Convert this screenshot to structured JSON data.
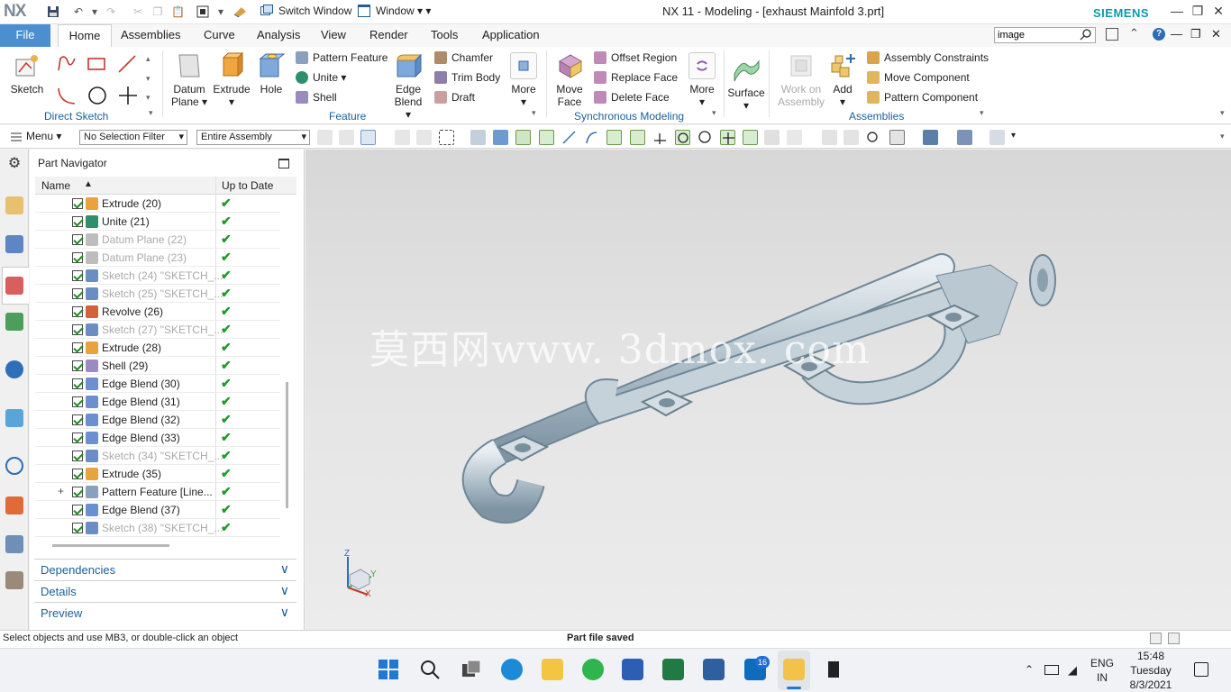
{
  "title_bar": {
    "logo": "NX",
    "switch_window": "Switch Window",
    "window_menu": "Window",
    "app_title": "NX 11 - Modeling - [exhaust Mainfold 3.prt]",
    "brand": "SIEMENS"
  },
  "tabs": {
    "file": "File",
    "items": [
      "Home",
      "Assemblies",
      "Curve",
      "Analysis",
      "View",
      "Render",
      "Tools",
      "Application"
    ],
    "active": "Home"
  },
  "search": {
    "value": "image"
  },
  "ribbon": {
    "sketch": "Sketch",
    "direct_sketch": "Direct Sketch",
    "datum_plane": "Datum Plane",
    "datum_plane_line1": "Datum",
    "datum_plane_line2": "Plane",
    "extrude": "Extrude",
    "hole": "Hole",
    "pattern_feature": "Pattern Feature",
    "unite": "Unite",
    "shell": "Shell",
    "edge_blend_line1": "Edge",
    "edge_blend_line2": "Blend",
    "chamfer": "Chamfer",
    "trim_body": "Trim Body",
    "draft": "Draft",
    "more": "More",
    "feature": "Feature",
    "move_face_line1": "Move",
    "move_face_line2": "Face",
    "offset_region": "Offset Region",
    "replace_face": "Replace Face",
    "delete_face": "Delete Face",
    "more2": "More",
    "synchronous_modeling": "Synchronous Modeling",
    "surface": "Surface",
    "work_on_line1": "Work on",
    "work_on_line2": "Assembly",
    "add": "Add",
    "assembly_constraints": "Assembly Constraints",
    "move_component": "Move Component",
    "pattern_component": "Pattern Component",
    "assemblies": "Assemblies"
  },
  "toolbar": {
    "menu": "Menu",
    "selection_filter": "No Selection Filter",
    "assembly_scope": "Entire Assembly"
  },
  "navigator": {
    "title": "Part Navigator",
    "col_name": "Name",
    "col_uptodate": "Up to Date",
    "rows": [
      {
        "label": "Extrude (20)",
        "dim": false,
        "color": "#e8a33c"
      },
      {
        "label": "Unite (21)",
        "dim": false,
        "color": "#2f8f6a"
      },
      {
        "label": "Datum Plane (22)",
        "dim": true,
        "color": "#bdbdbd"
      },
      {
        "label": "Datum Plane (23)",
        "dim": true,
        "color": "#bdbdbd"
      },
      {
        "label": "Sketch (24) \"SKETCH_...",
        "dim": true,
        "color": "#6a8ec4"
      },
      {
        "label": "Sketch (25) \"SKETCH_...",
        "dim": true,
        "color": "#6a8ec4"
      },
      {
        "label": "Revolve (26)",
        "dim": false,
        "color": "#d2623a"
      },
      {
        "label": "Sketch (27) \"SKETCH_...",
        "dim": true,
        "color": "#6a8ec4"
      },
      {
        "label": "Extrude (28)",
        "dim": false,
        "color": "#e8a33c"
      },
      {
        "label": "Shell (29)",
        "dim": false,
        "color": "#9a8cc0"
      },
      {
        "label": "Edge Blend (30)",
        "dim": false,
        "color": "#6c8fd0"
      },
      {
        "label": "Edge Blend (31)",
        "dim": false,
        "color": "#6c8fd0"
      },
      {
        "label": "Edge Blend (32)",
        "dim": false,
        "color": "#6c8fd0"
      },
      {
        "label": "Edge Blend (33)",
        "dim": false,
        "color": "#6c8fd0"
      },
      {
        "label": "Sketch (34) \"SKETCH_...",
        "dim": true,
        "color": "#6a8ec4"
      },
      {
        "label": "Extrude (35)",
        "dim": false,
        "color": "#e8a33c"
      },
      {
        "label": "Pattern Feature [Line...",
        "dim": false,
        "color": "#8aa0bd"
      },
      {
        "label": "Edge Blend (37)",
        "dim": false,
        "color": "#6c8fd0"
      },
      {
        "label": "Sketch (38) \"SKETCH_...",
        "dim": true,
        "color": "#6a8ec4"
      }
    ],
    "panels": [
      "Dependencies",
      "Details",
      "Preview"
    ]
  },
  "viewport": {
    "watermark": "莫西网www. 3dmox. com",
    "triad_z": "Z",
    "triad_y": "Y",
    "triad_x": "X"
  },
  "status": {
    "message": "Select objects and use MB3, or double-click an object",
    "saved": "Part file saved"
  },
  "taskbar": {
    "lang_line1": "ENG",
    "lang_line2": "IN",
    "time": "15:48",
    "day": "Tuesday",
    "date": "8/3/2021",
    "mail_badge": "16"
  },
  "colors": {
    "accent": "#4b8fd0",
    "group_label": "#1c5f99",
    "brand": "#0d9aa8",
    "ok_check": "#1f9a2a"
  }
}
